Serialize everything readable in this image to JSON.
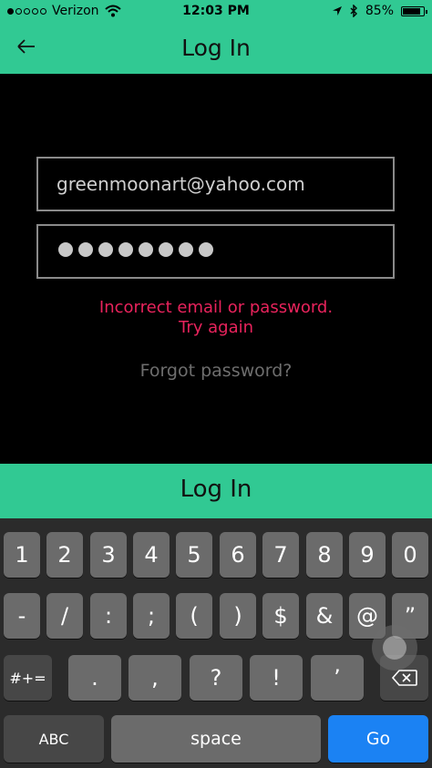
{
  "status": {
    "carrier": "Verizon",
    "signal_dots_total": 5,
    "signal_dots_filled": 1,
    "time": "12:03 PM",
    "battery": "85%",
    "battery_level": 0.85,
    "icons": [
      "wifi-icon",
      "location-arrow-icon",
      "bluetooth-icon",
      "battery-icon"
    ]
  },
  "nav": {
    "title": "Log In",
    "back_icon": "back-arrow-icon"
  },
  "form": {
    "email_value": "greenmoonart@yahoo.com",
    "password_dot_count": 8,
    "error_line1": "Incorrect email or password.",
    "error_line2": "Try again",
    "forgot_label": "Forgot password?",
    "login_label": "Log In"
  },
  "keyboard": {
    "row1": [
      "1",
      "2",
      "3",
      "4",
      "5",
      "6",
      "7",
      "8",
      "9",
      "0"
    ],
    "row2": [
      "-",
      "/",
      ":",
      ";",
      "(",
      ")",
      "$",
      "&",
      "@",
      "”"
    ],
    "row3_mode": "#+=",
    "row3": [
      ".",
      ",",
      "?",
      "!",
      "’"
    ],
    "delete_icon": "backspace-icon",
    "abc_label": "ABC",
    "space_label": "space",
    "go_label": "Go"
  },
  "colors": {
    "accent": "#31c993",
    "error": "#e8235c",
    "go_key": "#1b82f3"
  }
}
